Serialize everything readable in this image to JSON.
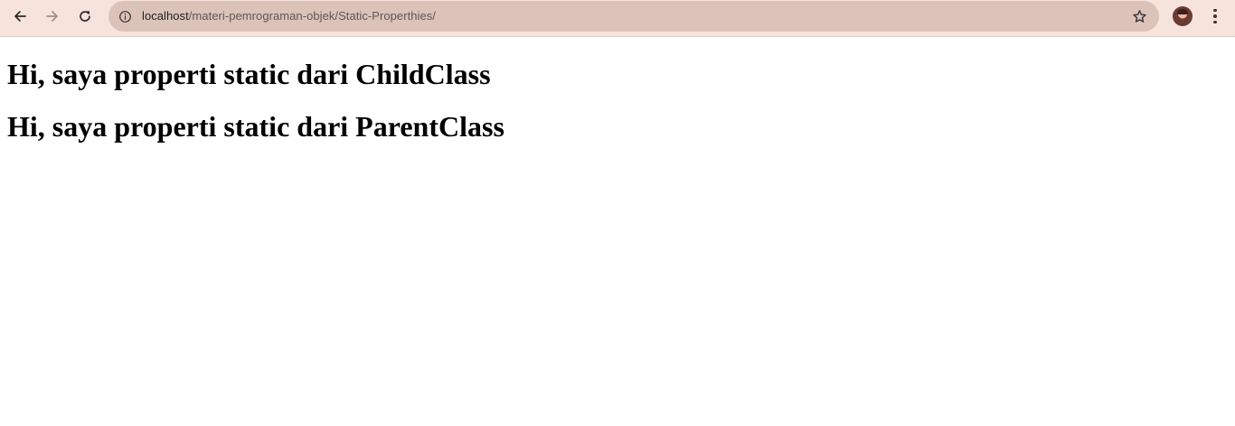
{
  "browser": {
    "url_host": "localhost",
    "url_path": "/materi-pemrograman-objek/Static-Properthies/",
    "toolbar_color": "#f6e3dc",
    "omnibox_color": "#dbc3ba",
    "icons": {
      "back": "arrow-left-icon",
      "forward": "arrow-right-icon",
      "reload": "reload-icon",
      "site_info": "info-icon",
      "bookmark": "star-icon",
      "profile": "avatar",
      "menu": "kebab-menu-icon"
    }
  },
  "page": {
    "headings": [
      "Hi, saya properti static dari ChildClass",
      "Hi, saya properti static dari ParentClass"
    ]
  }
}
